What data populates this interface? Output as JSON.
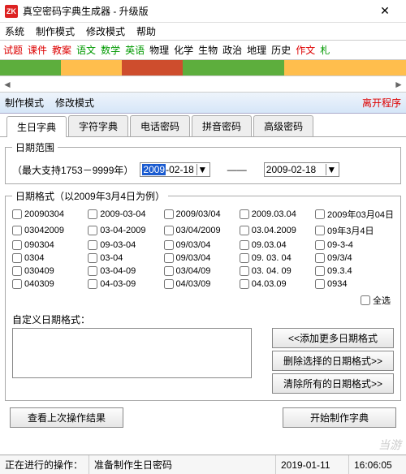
{
  "window": {
    "icon_text": "ZK",
    "title": "真空密码字典生成器 - 升级版",
    "close": "✕"
  },
  "menu": [
    "系统",
    "制作模式",
    "修改模式",
    "帮助"
  ],
  "subjects": [
    {
      "t": "试题",
      "c": "subj-red"
    },
    {
      "t": "课件",
      "c": "subj-red"
    },
    {
      "t": "教案",
      "c": "subj-red"
    },
    {
      "t": "语文",
      "c": "subj-green"
    },
    {
      "t": "数学",
      "c": "subj-green"
    },
    {
      "t": "英语",
      "c": "subj-green"
    },
    {
      "t": "物理",
      "c": "subj-black"
    },
    {
      "t": "化学",
      "c": "subj-black"
    },
    {
      "t": "生物",
      "c": "subj-black"
    },
    {
      "t": "政治",
      "c": "subj-black"
    },
    {
      "t": "地理",
      "c": "subj-black"
    },
    {
      "t": "历史",
      "c": "subj-black"
    },
    {
      "t": "作文",
      "c": "subj-red"
    },
    {
      "t": "札",
      "c": "subj-green"
    }
  ],
  "scroll": {
    "left": "◄",
    "right": "►"
  },
  "modebar": {
    "make": "制作模式",
    "modify": "修改模式",
    "leave": "离开程序"
  },
  "tabs": [
    "生日字典",
    "字符字典",
    "电话密码",
    "拼音密码",
    "高级密码"
  ],
  "date_range": {
    "legend": "日期范围",
    "support": "（最大支持1753－9999年）",
    "from_sel": "2009",
    "from_rest": "-02-18",
    "to": "2009-02-18",
    "dd": "▼",
    "dash": "——"
  },
  "fmt": {
    "legend": "日期格式（以2009年3月4日为例）",
    "items": [
      "20090304",
      "2009-03-04",
      "2009/03/04",
      "2009.03.04",
      "2009年03月04日",
      "03042009",
      "03-04-2009",
      "03/04/2009",
      "03.04.2009",
      "09年3月4日",
      "090304",
      "09-03-04",
      "09/03/04",
      "09.03.04",
      "09-3-4",
      "0304",
      "03-04",
      "09/03/04",
      "09. 03. 04",
      "09/3/4",
      "030409",
      "03-04-09",
      "03/04/09",
      "03. 04. 09",
      "09.3.4",
      "040309",
      "04-03-09",
      "04/03/09",
      "04.03.09",
      "0934"
    ],
    "select_all": "全选",
    "custom_label": "自定义日期格式：",
    "btn_add": "<<添加更多日期格式",
    "btn_del": "删除选择的日期格式>>",
    "btn_clear": "清除所有的日期格式>>"
  },
  "bottom": {
    "view_last": "查看上次操作结果",
    "start": "开始制作字典"
  },
  "status": {
    "op_label": "正在进行的操作：",
    "msg": "准备制作生日密码",
    "date": "2019-01-11",
    "time": "16:06:05"
  },
  "watermark": "当游"
}
